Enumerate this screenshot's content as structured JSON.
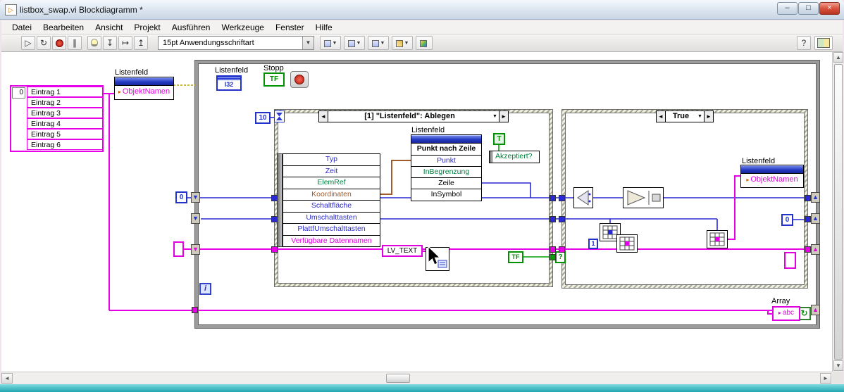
{
  "window": {
    "title": "listbox_swap.vi Blockdiagramm *",
    "minimize": "–",
    "maximize": "□",
    "close": "×"
  },
  "menu": {
    "items": [
      "Datei",
      "Bearbeiten",
      "Ansicht",
      "Projekt",
      "Ausführen",
      "Werkzeuge",
      "Fenster",
      "Hilfe"
    ]
  },
  "toolbar": {
    "font_selector": "15pt Anwendungsschriftart",
    "help_label": "?"
  },
  "icons": {
    "run": "▷",
    "run_continuous": "↻",
    "pause": "∥",
    "step_into": "↧",
    "step_over": "↦",
    "step_out": "↥",
    "dropdown": "▼",
    "left": "◄",
    "right": "►",
    "up": "▲",
    "down": "▼",
    "small": "▸",
    "condition": "↻",
    "scroll_left": "◄",
    "scroll_right": "►",
    "scroll_up": "▲",
    "scroll_down": "▼"
  },
  "colors": {
    "wire_magenta": "#e800e8",
    "wire_blue": "#2a2ad4",
    "wire_green": "#00a000",
    "wire_brown": "#a05a2c",
    "accent_teal": "#22a6b0"
  },
  "diagram": {
    "array_constant": {
      "index": "0",
      "items": [
        "Eintrag 1",
        "Eintrag 2",
        "Eintrag 3",
        "Eintrag 4",
        "Eintrag 5",
        "Eintrag 6"
      ]
    },
    "prop_left": {
      "label": "Listenfeld",
      "row": "ObjektNamen"
    },
    "terminal": {
      "label": "Listenfeld",
      "type": "I32"
    },
    "stop": {
      "label": "Stopp",
      "type": "TF"
    },
    "event": {
      "timeout": "10",
      "header": "[1] \"Listenfeld\": Ablegen",
      "fields": [
        "Typ",
        "Zeit",
        "ElemRef",
        "Koordinaten",
        "Schaltfläche",
        "Umschalttasten",
        "PlattfUmschalttasten",
        "Verfügbare Datennamen"
      ],
      "accepted_const": "T",
      "accepted_label": "Akzeptiert?",
      "tf_const": "TF",
      "selector": "?"
    },
    "invoke": {
      "label": "Listenfeld",
      "method": "Punkt nach Zeile",
      "rows": [
        "Punkt",
        "InBegrenzung",
        "Zeile",
        "InSymbol"
      ]
    },
    "lv_text": "LV_TEXT",
    "case": {
      "selector": "True",
      "one": "1"
    },
    "prop_right": {
      "label": "Listenfeld",
      "row": "ObjektNamen"
    },
    "zero_left": "0",
    "zero_right": "0",
    "iteration": "i",
    "array_indicator": {
      "label": "Array",
      "text": "abc"
    }
  }
}
